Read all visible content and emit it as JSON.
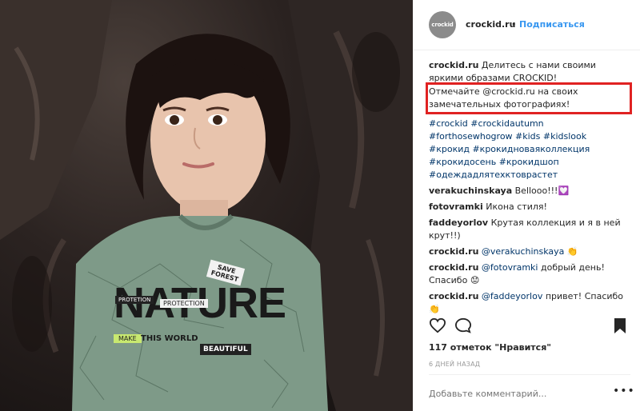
{
  "post": {
    "username": "crockid.ru",
    "avatar_text": "crockid",
    "dot": "•",
    "follow_label": "Подписаться",
    "caption_line1": "Делитесь с нами своими яркими образами CROCKID!",
    "caption_highlight": "Отмечайте @crockid.ru на своих замечательных фотографиях!",
    "hashtags": "#crockid #crockidautumn #forthosewhogrow #kids #kidslook #крокид #крокидноваяколлекция #крокидосень #крокидшоп #одеждадлятехктоврастет",
    "likes": "117 отметок \"Нравится\"",
    "time_ago": "6 ДНЕЙ НАЗАД",
    "add_comment_placeholder": "Добавьте комментарий...",
    "more": "•••"
  },
  "comments": [
    {
      "user": "verakuchinskaya",
      "text": "Bellooo!!!💟"
    },
    {
      "user": "fotovramki",
      "text": "Икона стиля!"
    },
    {
      "user": "faddeyorlov",
      "text": "Крутая коллекция и я в ней крут!!)"
    },
    {
      "user": "crockid.ru",
      "mention": "@verakuchinskaya",
      "text": "👏"
    },
    {
      "user": "crockid.ru",
      "mention": "@fotovramki",
      "text": "добрый день! Спасибо 😟"
    },
    {
      "user": "crockid.ru",
      "mention": "@faddeyorlov",
      "text": "привет! Спасибо 👏"
    }
  ],
  "shirt_print": {
    "word": "NATURE",
    "save_forest": "SAVE FOREST",
    "protection1": "PROTETION",
    "protection2": "PROTECTION",
    "make": "MAKE",
    "this_world": "THIS WORLD",
    "beautiful": "BEAUTIFUL"
  },
  "icons": {
    "like": "heart-icon",
    "comment": "comment-icon",
    "save": "bookmark-icon"
  },
  "colors": {
    "accent": "#3897f0",
    "highlight_box": "#e02222",
    "shirt": "#7e9a88"
  }
}
